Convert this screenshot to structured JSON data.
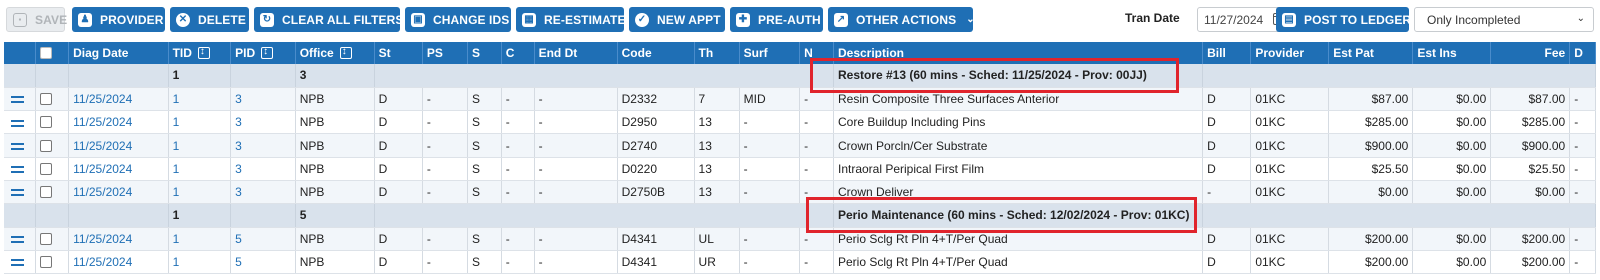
{
  "toolbar": {
    "save": "SAVE",
    "provider": "PROVIDER",
    "delete": "DELETE",
    "clear_filters": "CLEAR ALL FILTERS",
    "change_ids": "CHANGE IDS",
    "re_estimate": "RE-ESTIMATE",
    "new_appt": "NEW APPT",
    "pre_auth": "PRE-AUTH",
    "other_actions": "OTHER ACTIONS",
    "tran_date_label": "Tran Date",
    "tran_date_value": "11/27/2024",
    "post_to_ledger": "POST TO LEDGER",
    "status_filter": "Only Incompleted"
  },
  "colors": {
    "accent": "#1f6fb5",
    "group_row": "#d9e2ec",
    "highlight": "#e0242c"
  },
  "columns": [
    "Diag Date",
    "TID",
    "PID",
    "Office",
    "St",
    "PS",
    "S",
    "C",
    "End Dt",
    "Code",
    "Th",
    "Surf",
    "N",
    "Description",
    "Bill",
    "Provider",
    "Est Pat",
    "Est Ins",
    "Fee",
    "D"
  ],
  "groups": [
    {
      "tid": "1",
      "pid": "3",
      "label": "Restore #13 (60 mins - Sched: 11/25/2024 - Prov: 00JJ)",
      "rows": [
        {
          "diag_date": "11/25/2024",
          "tid": "1",
          "pid": "3",
          "office": "NPB",
          "st": "D",
          "ps": "-",
          "s": "S",
          "c": "-",
          "end_dt": "-",
          "code": "D2332",
          "th": "7",
          "surf": "MID",
          "n": "-",
          "description": "Resin Composite Three Surfaces Anterior",
          "bill": "D",
          "provider": "01KC",
          "est_pat": "$87.00",
          "est_ins": "$0.00",
          "fee": "$87.00",
          "d": "-"
        },
        {
          "diag_date": "11/25/2024",
          "tid": "1",
          "pid": "3",
          "office": "NPB",
          "st": "D",
          "ps": "-",
          "s": "S",
          "c": "-",
          "end_dt": "-",
          "code": "D2950",
          "th": "13",
          "surf": "-",
          "n": "-",
          "description": "Core Buildup Including Pins",
          "bill": "D",
          "provider": "01KC",
          "est_pat": "$285.00",
          "est_ins": "$0.00",
          "fee": "$285.00",
          "d": "-"
        },
        {
          "diag_date": "11/25/2024",
          "tid": "1",
          "pid": "3",
          "office": "NPB",
          "st": "D",
          "ps": "-",
          "s": "S",
          "c": "-",
          "end_dt": "-",
          "code": "D2740",
          "th": "13",
          "surf": "-",
          "n": "-",
          "description": "Crown Porcln/Cer Substrate",
          "bill": "D",
          "provider": "01KC",
          "est_pat": "$900.00",
          "est_ins": "$0.00",
          "fee": "$900.00",
          "d": "-"
        },
        {
          "diag_date": "11/25/2024",
          "tid": "1",
          "pid": "3",
          "office": "NPB",
          "st": "D",
          "ps": "-",
          "s": "S",
          "c": "-",
          "end_dt": "-",
          "code": "D0220",
          "th": "13",
          "surf": "-",
          "n": "-",
          "description": "Intraoral Peripical First Film",
          "bill": "D",
          "provider": "01KC",
          "est_pat": "$25.50",
          "est_ins": "$0.00",
          "fee": "$25.50",
          "d": "-"
        },
        {
          "diag_date": "11/25/2024",
          "tid": "1",
          "pid": "3",
          "office": "NPB",
          "st": "D",
          "ps": "-",
          "s": "S",
          "c": "-",
          "end_dt": "-",
          "code": "D2750B",
          "th": "13",
          "surf": "-",
          "n": "-",
          "description": "Crown Deliver",
          "bill": "-",
          "provider": "01KC",
          "est_pat": "$0.00",
          "est_ins": "$0.00",
          "fee": "$0.00",
          "d": "-"
        }
      ]
    },
    {
      "tid": "1",
      "pid": "5",
      "label": "Perio Maintenance (60 mins - Sched: 12/02/2024 - Prov: 01KC)",
      "rows": [
        {
          "diag_date": "11/25/2024",
          "tid": "1",
          "pid": "5",
          "office": "NPB",
          "st": "D",
          "ps": "-",
          "s": "S",
          "c": "-",
          "end_dt": "-",
          "code": "D4341",
          "th": "UL",
          "surf": "-",
          "n": "-",
          "description": "Perio Sclg Rt Pln 4+T/Per Quad",
          "bill": "D",
          "provider": "01KC",
          "est_pat": "$200.00",
          "est_ins": "$0.00",
          "fee": "$200.00",
          "d": "-"
        },
        {
          "diag_date": "11/25/2024",
          "tid": "1",
          "pid": "5",
          "office": "NPB",
          "st": "D",
          "ps": "-",
          "s": "S",
          "c": "-",
          "end_dt": "-",
          "code": "D4341",
          "th": "UR",
          "surf": "-",
          "n": "-",
          "description": "Perio Sclg Rt Pln 4+T/Per Quad",
          "bill": "D",
          "provider": "01KC",
          "est_pat": "$200.00",
          "est_ins": "$0.00",
          "fee": "$200.00",
          "d": "-"
        }
      ]
    }
  ]
}
